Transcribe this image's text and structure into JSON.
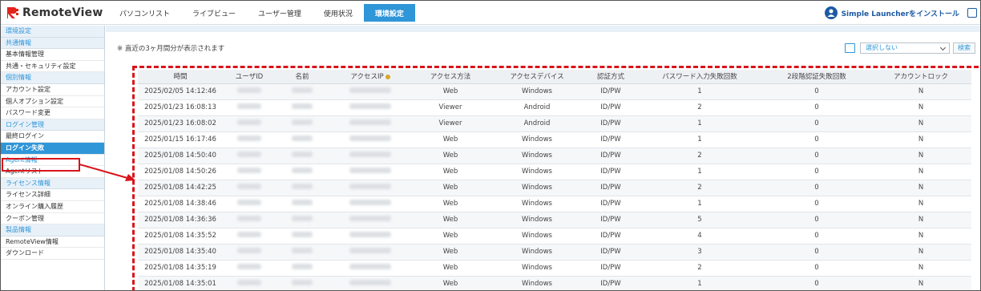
{
  "header": {
    "logo_text": "RemoteView",
    "tabs": [
      {
        "label": "パソコンリスト",
        "active": false
      },
      {
        "label": "ライブビュー",
        "active": false
      },
      {
        "label": "ユーザー管理",
        "active": false
      },
      {
        "label": "使用状況",
        "active": false
      },
      {
        "label": "環境設定",
        "active": true
      }
    ],
    "install_label": "Simple Launcherをインストール"
  },
  "sidebar": {
    "sections": [
      {
        "title": "環境設定",
        "items": []
      },
      {
        "title": "共通情報",
        "items": [
          {
            "label": "基本情報管理"
          },
          {
            "label": "共通・セキュリティ設定"
          }
        ]
      },
      {
        "title": "個別情報",
        "items": [
          {
            "label": "アカウント設定"
          },
          {
            "label": "個人オプション設定"
          },
          {
            "label": "パスワード変更"
          }
        ]
      },
      {
        "title": "ログイン管理",
        "items": [
          {
            "label": "最終ログイン"
          },
          {
            "label": "ログイン失敗",
            "active": true
          }
        ]
      },
      {
        "title": "",
        "items": [
          {
            "label": "Agent情報",
            "link": true
          },
          {
            "label": "Agentリスト"
          }
        ]
      },
      {
        "title": "ライセンス情報",
        "items": [
          {
            "label": "ライセンス詳細"
          },
          {
            "label": "オンライン購入履歴"
          },
          {
            "label": "クーポン管理"
          }
        ]
      },
      {
        "title": "製品情報",
        "items": [
          {
            "label": "RemoteView情報"
          },
          {
            "label": "ダウンロード"
          }
        ]
      }
    ]
  },
  "main": {
    "note": "※ 直近の3ヶ月間分が表示されます",
    "filter": {
      "selected": "選択しない",
      "search_label": "検索"
    },
    "table": {
      "columns": [
        "時間",
        "ユーザID",
        "名前",
        "アクセスIP",
        "アクセス方法",
        "アクセスデバイス",
        "認証方式",
        "パスワード入力失敗回数",
        "2段階認証失敗回数",
        "アカウントロック"
      ],
      "rows": [
        [
          "2025/02/05 14:12:46",
          "",
          "",
          "",
          "Web",
          "Windows",
          "ID/PW",
          "1",
          "0",
          "N"
        ],
        [
          "2025/01/23 16:08:13",
          "",
          "",
          "",
          "Viewer",
          "Android",
          "ID/PW",
          "2",
          "0",
          "N"
        ],
        [
          "2025/01/23 16:08:02",
          "",
          "",
          "",
          "Viewer",
          "Android",
          "ID/PW",
          "1",
          "0",
          "N"
        ],
        [
          "2025/01/15 16:17:46",
          "",
          "",
          "",
          "Web",
          "Windows",
          "ID/PW",
          "1",
          "0",
          "N"
        ],
        [
          "2025/01/08 14:50:40",
          "",
          "",
          "",
          "Web",
          "Windows",
          "ID/PW",
          "2",
          "0",
          "N"
        ],
        [
          "2025/01/08 14:50:26",
          "",
          "",
          "",
          "Web",
          "Windows",
          "ID/PW",
          "1",
          "0",
          "N"
        ],
        [
          "2025/01/08 14:42:25",
          "",
          "",
          "",
          "Web",
          "Windows",
          "ID/PW",
          "2",
          "0",
          "N"
        ],
        [
          "2025/01/08 14:38:46",
          "",
          "",
          "",
          "Web",
          "Windows",
          "ID/PW",
          "1",
          "0",
          "N"
        ],
        [
          "2025/01/08 14:36:36",
          "",
          "",
          "",
          "Web",
          "Windows",
          "ID/PW",
          "5",
          "0",
          "N"
        ],
        [
          "2025/01/08 14:35:52",
          "",
          "",
          "",
          "Web",
          "Windows",
          "ID/PW",
          "4",
          "0",
          "N"
        ],
        [
          "2025/01/08 14:35:40",
          "",
          "",
          "",
          "Web",
          "Windows",
          "ID/PW",
          "3",
          "0",
          "N"
        ],
        [
          "2025/01/08 14:35:19",
          "",
          "",
          "",
          "Web",
          "Windows",
          "ID/PW",
          "2",
          "0",
          "N"
        ],
        [
          "2025/01/08 14:35:01",
          "",
          "",
          "",
          "Web",
          "Windows",
          "ID/PW",
          "1",
          "0",
          "N"
        ]
      ]
    }
  },
  "colors": {
    "accent": "#2f96d8",
    "annotation": "#d9141b",
    "brand_red": "#e2231a"
  }
}
